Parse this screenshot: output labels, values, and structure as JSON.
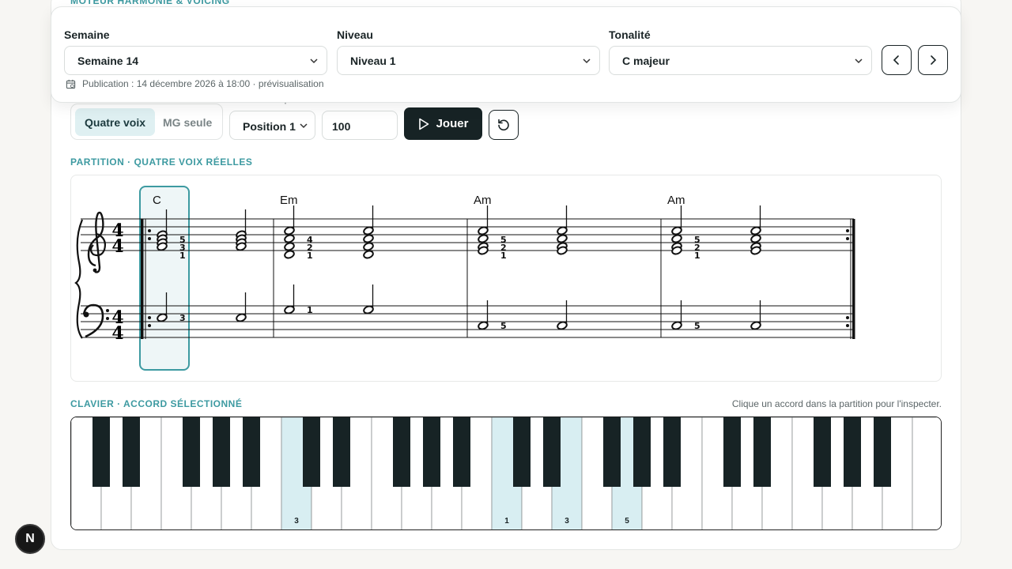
{
  "app_section_title": "MOTEUR HARMONIE & VOICING",
  "header": {
    "semaine_label": "Semaine",
    "semaine_value": "Semaine 14",
    "niveau_label": "Niveau",
    "niveau_value": "Niveau 1",
    "tonalite_label": "Tonalité",
    "tonalite_value": "C majeur",
    "publication": "Publication : 14 décembre 2026 à 18:00 · prévisualisation"
  },
  "controls": {
    "voicing_tabs": [
      {
        "label": "Quatre voix",
        "active": true
      },
      {
        "label": "MG seule",
        "active": false
      }
    ],
    "position_label": "Position de départ",
    "position_value": "Position 1",
    "tempo_value": "100",
    "play_label": "Jouer"
  },
  "score": {
    "title": "PARTITION · QUATRE VOIX RÉELLES",
    "time_signature": "4/4",
    "chords": [
      "C",
      "Em",
      "Am",
      "Am"
    ],
    "fingerings_treble": [
      [
        "5",
        "3",
        "1"
      ],
      [
        "4",
        "2",
        "1"
      ],
      [
        "5",
        "2",
        "1"
      ],
      [
        "5",
        "2",
        "1"
      ]
    ],
    "fingerings_bass": [
      "3",
      "1",
      "5",
      "5"
    ],
    "selected_measure": 1,
    "accent_color": "#3d9aa1",
    "selection_fill": "#eef6f7"
  },
  "keyboard": {
    "title": "CLAVIER · ACCORD SÉLECTIONNÉ",
    "hint": "Clique un accord dans la partition pour l'inspecter.",
    "white_key_count": 29,
    "highlighted": [
      {
        "key_index": 7,
        "finger": "3"
      },
      {
        "key_index": 14,
        "finger": "1"
      },
      {
        "key_index": 16,
        "finger": "3"
      },
      {
        "key_index": 18,
        "finger": "5"
      }
    ],
    "highlight_color": "#d8eef2"
  },
  "icons": {
    "calendar": "calendar-icon",
    "prev": "chevron-left-icon",
    "next": "chevron-right-icon",
    "play": "play-icon",
    "reset": "reset-icon",
    "badge": "next-logo-icon"
  },
  "badge_letter": "N"
}
